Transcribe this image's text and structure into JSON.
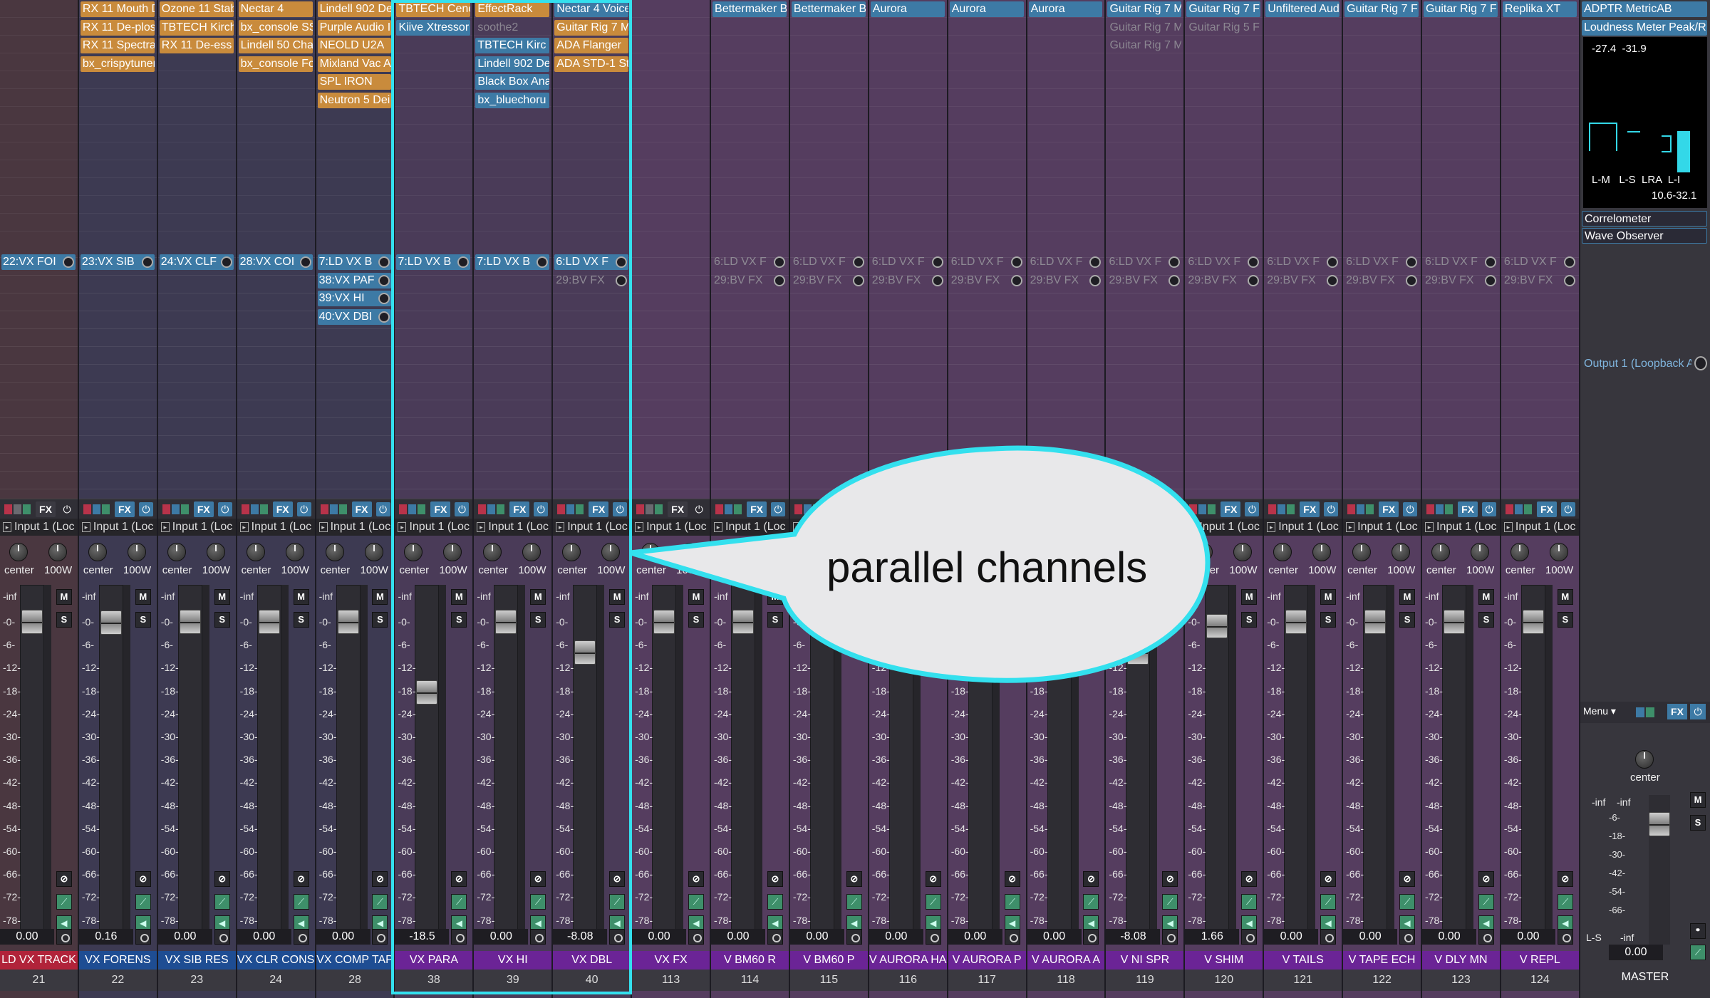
{
  "colors": {
    "accent": "#33e0ee",
    "plugin_orange": "#c98b3c",
    "plugin_blue": "#3d7aa5",
    "name_red": "#b1233a",
    "name_purple": "#6b2496",
    "name_blue": "#1e4d93"
  },
  "common": {
    "pan_label": "center",
    "width_label": "100W",
    "input_label": "Input 1 (Loc",
    "fx_label": "FX",
    "mute_label": "M",
    "solo_label": "S",
    "scale": [
      "-inf",
      "-0-",
      "-6-",
      "-12-",
      "-18-",
      "-24-",
      "-30-",
      "-36-",
      "-42-",
      "-48-",
      "-54-",
      "-60-",
      "-66-",
      "-72-",
      "-78-"
    ]
  },
  "channels": [
    {
      "name": "LD VX TRACK",
      "number": "21",
      "bg": "#4a3740",
      "name_color": "#b1233a",
      "inserts": [],
      "sends": [
        {
          "label": "22:VX FOI",
          "dim": false
        }
      ],
      "volume": "0.00",
      "fader_db": 0,
      "fx_blue": false
    },
    {
      "name": "VX FORENS",
      "number": "22",
      "bg": "#3d3a52",
      "name_color": "#1e4d93",
      "inserts": [
        {
          "label": "RX 11 Mouth D",
          "c": "o"
        },
        {
          "label": "RX 11 De-plos",
          "c": "o"
        },
        {
          "label": "RX 11 Spectra",
          "c": "o"
        },
        {
          "label": "bx_crispytuner",
          "c": "o"
        }
      ],
      "sends": [
        {
          "label": "23:VX SIB",
          "dim": false
        }
      ],
      "volume": "0.16",
      "fader_db": 0.16,
      "fx_blue": true
    },
    {
      "name": "VX SIB RES",
      "number": "23",
      "bg": "#3d3a52",
      "name_color": "#1e4d93",
      "inserts": [
        {
          "label": "Ozone 11 Stab",
          "c": "o"
        },
        {
          "label": "TBTECH Kirch",
          "c": "o"
        },
        {
          "label": "RX 11 De-ess",
          "c": "o"
        }
      ],
      "sends": [
        {
          "label": "24:VX CLF",
          "dim": false
        }
      ],
      "volume": "0.00",
      "fader_db": 0,
      "fx_blue": true
    },
    {
      "name": "VX CLR CONS",
      "number": "24",
      "bg": "#3d3a52",
      "name_color": "#1e4d93",
      "inserts": [
        {
          "label": "Nectar 4",
          "c": "o"
        },
        {
          "label": "bx_console SS",
          "c": "o"
        },
        {
          "label": "Lindell 50 Cha",
          "c": "o"
        },
        {
          "label": "bx_console Fo",
          "c": "o"
        }
      ],
      "sends": [
        {
          "label": "28:VX COI",
          "dim": false
        }
      ],
      "volume": "0.00",
      "fader_db": 0,
      "fx_blue": true
    },
    {
      "name": "VX COMP TAP",
      "number": "28",
      "bg": "#3d3a52",
      "name_color": "#1e4d93",
      "inserts": [
        {
          "label": "Lindell 902 De",
          "c": "o"
        },
        {
          "label": "Purple Audio I",
          "c": "o"
        },
        {
          "label": "NEOLD U2A",
          "c": "o"
        },
        {
          "label": "Mixland Vac A",
          "c": "o"
        },
        {
          "label": "SPL IRON",
          "c": "o"
        },
        {
          "label": "Neutron 5 Dei",
          "c": "o"
        }
      ],
      "sends": [
        {
          "label": "7:LD VX B",
          "dim": false
        },
        {
          "label": "38:VX PAF",
          "dim": false
        },
        {
          "label": "39:VX HI",
          "dim": false
        },
        {
          "label": "40:VX DBI",
          "dim": false
        }
      ],
      "volume": "0.00",
      "fader_db": 0,
      "fx_blue": true
    },
    {
      "name": "VX PARA",
      "number": "38",
      "bg": "#4a3b58",
      "name_color": "#6b2496",
      "inserts": [
        {
          "label": "TBTECH Cenc",
          "c": "o"
        },
        {
          "label": "Kiive Xtressor",
          "c": "b"
        }
      ],
      "sends": [
        {
          "label": "7:LD VX B",
          "dim": false
        }
      ],
      "volume": "-18.5",
      "fader_db": -18.5,
      "fx_blue": true
    },
    {
      "name": "VX HI",
      "number": "39",
      "bg": "#4a3b58",
      "name_color": "#6b2496",
      "inserts": [
        {
          "label": "EffectRack",
          "c": "o"
        },
        {
          "label": "soothe2",
          "c": "g"
        },
        {
          "label": "TBTECH Kirc",
          "c": "b"
        },
        {
          "label": "Lindell 902 De",
          "c": "b"
        },
        {
          "label": "Black Box Ana",
          "c": "b"
        },
        {
          "label": "bx_bluechoru",
          "c": "b"
        }
      ],
      "sends": [
        {
          "label": "7:LD VX B",
          "dim": false
        }
      ],
      "volume": "0.00",
      "fader_db": 0,
      "fx_blue": true
    },
    {
      "name": "VX DBL",
      "number": "40",
      "bg": "#4a3b58",
      "name_color": "#6b2496",
      "inserts": [
        {
          "label": "Nectar 4 Voice",
          "c": "b"
        },
        {
          "label": "Guitar Rig 7 M",
          "c": "o"
        },
        {
          "label": "ADA Flanger",
          "c": "o"
        },
        {
          "label": "ADA STD-1 St",
          "c": "o"
        }
      ],
      "sends": [
        {
          "label": "6:LD VX F",
          "dim": false
        },
        {
          "label": "29:BV FX",
          "dim": true
        }
      ],
      "volume": "-8.08",
      "fader_db": -8.08,
      "fx_blue": true
    },
    {
      "name": "VX FX",
      "number": "113",
      "bg": "#553d5f",
      "name_color": "#6b2496",
      "inserts": [],
      "sends": [],
      "volume": "0.00",
      "fader_db": 0,
      "fx_blue": false
    },
    {
      "name": "V BM60 R",
      "number": "114",
      "bg": "#553d5f",
      "name_color": "#6b2496",
      "inserts": [
        {
          "label": "Bettermaker B",
          "c": "b"
        }
      ],
      "sends": [
        {
          "label": "6:LD VX F",
          "dim": true
        },
        {
          "label": "29:BV FX",
          "dim": true
        }
      ],
      "volume": "0.00",
      "fader_db": 0,
      "fx_blue": true
    },
    {
      "name": "V BM60 P",
      "number": "115",
      "bg": "#553d5f",
      "name_color": "#6b2496",
      "inserts": [
        {
          "label": "Bettermaker B",
          "c": "b"
        }
      ],
      "sends": [
        {
          "label": "6:LD VX F",
          "dim": true
        },
        {
          "label": "29:BV FX",
          "dim": true
        }
      ],
      "volume": "0.00",
      "fader_db": 0,
      "fx_blue": true
    },
    {
      "name": "V AURORA HA",
      "number": "116",
      "bg": "#553d5f",
      "name_color": "#6b2496",
      "inserts": [
        {
          "label": "Aurora",
          "c": "b"
        }
      ],
      "sends": [
        {
          "label": "6:LD VX F",
          "dim": true
        },
        {
          "label": "29:BV FX",
          "dim": true
        }
      ],
      "volume": "0.00",
      "fader_db": 0,
      "fx_blue": true
    },
    {
      "name": "V AURORA P",
      "number": "117",
      "bg": "#553d5f",
      "name_color": "#6b2496",
      "inserts": [
        {
          "label": "Aurora",
          "c": "b"
        }
      ],
      "sends": [
        {
          "label": "6:LD VX F",
          "dim": true
        },
        {
          "label": "29:BV FX",
          "dim": true
        }
      ],
      "volume": "0.00",
      "fader_db": 0,
      "fx_blue": true
    },
    {
      "name": "V AURORA A",
      "number": "118",
      "bg": "#553d5f",
      "name_color": "#6b2496",
      "inserts": [
        {
          "label": "Aurora",
          "c": "b"
        }
      ],
      "sends": [
        {
          "label": "6:LD VX F",
          "dim": true
        },
        {
          "label": "29:BV FX",
          "dim": true
        }
      ],
      "volume": "0.00",
      "fader_db": 0,
      "fx_blue": true
    },
    {
      "name": "V NI SPR",
      "number": "119",
      "bg": "#553d5f",
      "name_color": "#6b2496",
      "inserts": [
        {
          "label": "Guitar Rig 7 M",
          "c": "b"
        },
        {
          "label": "Guitar Rig 7 M",
          "c": "g"
        },
        {
          "label": "Guitar Rig 7 M",
          "c": "g"
        }
      ],
      "sends": [
        {
          "label": "6:LD VX F",
          "dim": true
        },
        {
          "label": "29:BV FX",
          "dim": true
        }
      ],
      "volume": "-8.08",
      "fader_db": -8.08,
      "fx_blue": true
    },
    {
      "name": "V SHIM",
      "number": "120",
      "bg": "#553d5f",
      "name_color": "#6b2496",
      "inserts": [
        {
          "label": "Guitar Rig 7 F",
          "c": "b"
        },
        {
          "label": "Guitar Rig 5 F",
          "c": "g"
        }
      ],
      "sends": [
        {
          "label": "6:LD VX F",
          "dim": true
        },
        {
          "label": "29:BV FX",
          "dim": true
        }
      ],
      "volume": "1.66",
      "fader_db": 1.66,
      "fx_blue": true
    },
    {
      "name": "V TAILS",
      "number": "121",
      "bg": "#553d5f",
      "name_color": "#6b2496",
      "inserts": [
        {
          "label": "Unfiltered Audi",
          "c": "b"
        }
      ],
      "sends": [
        {
          "label": "6:LD VX F",
          "dim": true
        },
        {
          "label": "29:BV FX",
          "dim": true
        }
      ],
      "volume": "0.00",
      "fader_db": 0,
      "fx_blue": true
    },
    {
      "name": "V TAPE ECH",
      "number": "122",
      "bg": "#553d5f",
      "name_color": "#6b2496",
      "inserts": [
        {
          "label": "Guitar Rig 7 F",
          "c": "b"
        }
      ],
      "sends": [
        {
          "label": "6:LD VX F",
          "dim": true
        },
        {
          "label": "29:BV FX",
          "dim": true
        }
      ],
      "volume": "0.00",
      "fader_db": 0,
      "fx_blue": true
    },
    {
      "name": "V DLY MN",
      "number": "123",
      "bg": "#553d5f",
      "name_color": "#6b2496",
      "inserts": [
        {
          "label": "Guitar Rig 7 F",
          "c": "b"
        }
      ],
      "sends": [
        {
          "label": "6:LD VX F",
          "dim": true
        },
        {
          "label": "29:BV FX",
          "dim": true
        }
      ],
      "volume": "0.00",
      "fader_db": 0,
      "fx_blue": true
    },
    {
      "name": "V REPL",
      "number": "124",
      "bg": "#553d5f",
      "name_color": "#6b2496",
      "inserts": [
        {
          "label": "Replika XT",
          "c": "b"
        }
      ],
      "sends": [
        {
          "label": "6:LD VX F",
          "dim": true
        },
        {
          "label": "29:BV FX",
          "dim": true
        }
      ],
      "volume": "0.00",
      "fader_db": 0,
      "fx_blue": true
    }
  ],
  "master": {
    "inserts": [
      "ADPTR MetricAB",
      "Loudness Meter Peak/R"
    ],
    "loudness_values": "-27.4  -31.9",
    "loudness_labels": "L-M   L-S  LRA  L-I",
    "lra_value": "10.6-32.1",
    "extra_inserts": [
      "Correlometer",
      "Wave Observer"
    ],
    "output": "Output 1 (Loopback A",
    "menu_label": "Menu",
    "pan_label": "center",
    "peaks": "-inf    -inf",
    "scale": [
      "-6-",
      "-18-",
      "-30-",
      "-42-",
      "-54-",
      "-66-"
    ],
    "ls_label": "L-S",
    "ls_value": "-inf",
    "volume": "0.00",
    "name": "MASTER"
  },
  "annotation": {
    "text": "parallel channels"
  }
}
